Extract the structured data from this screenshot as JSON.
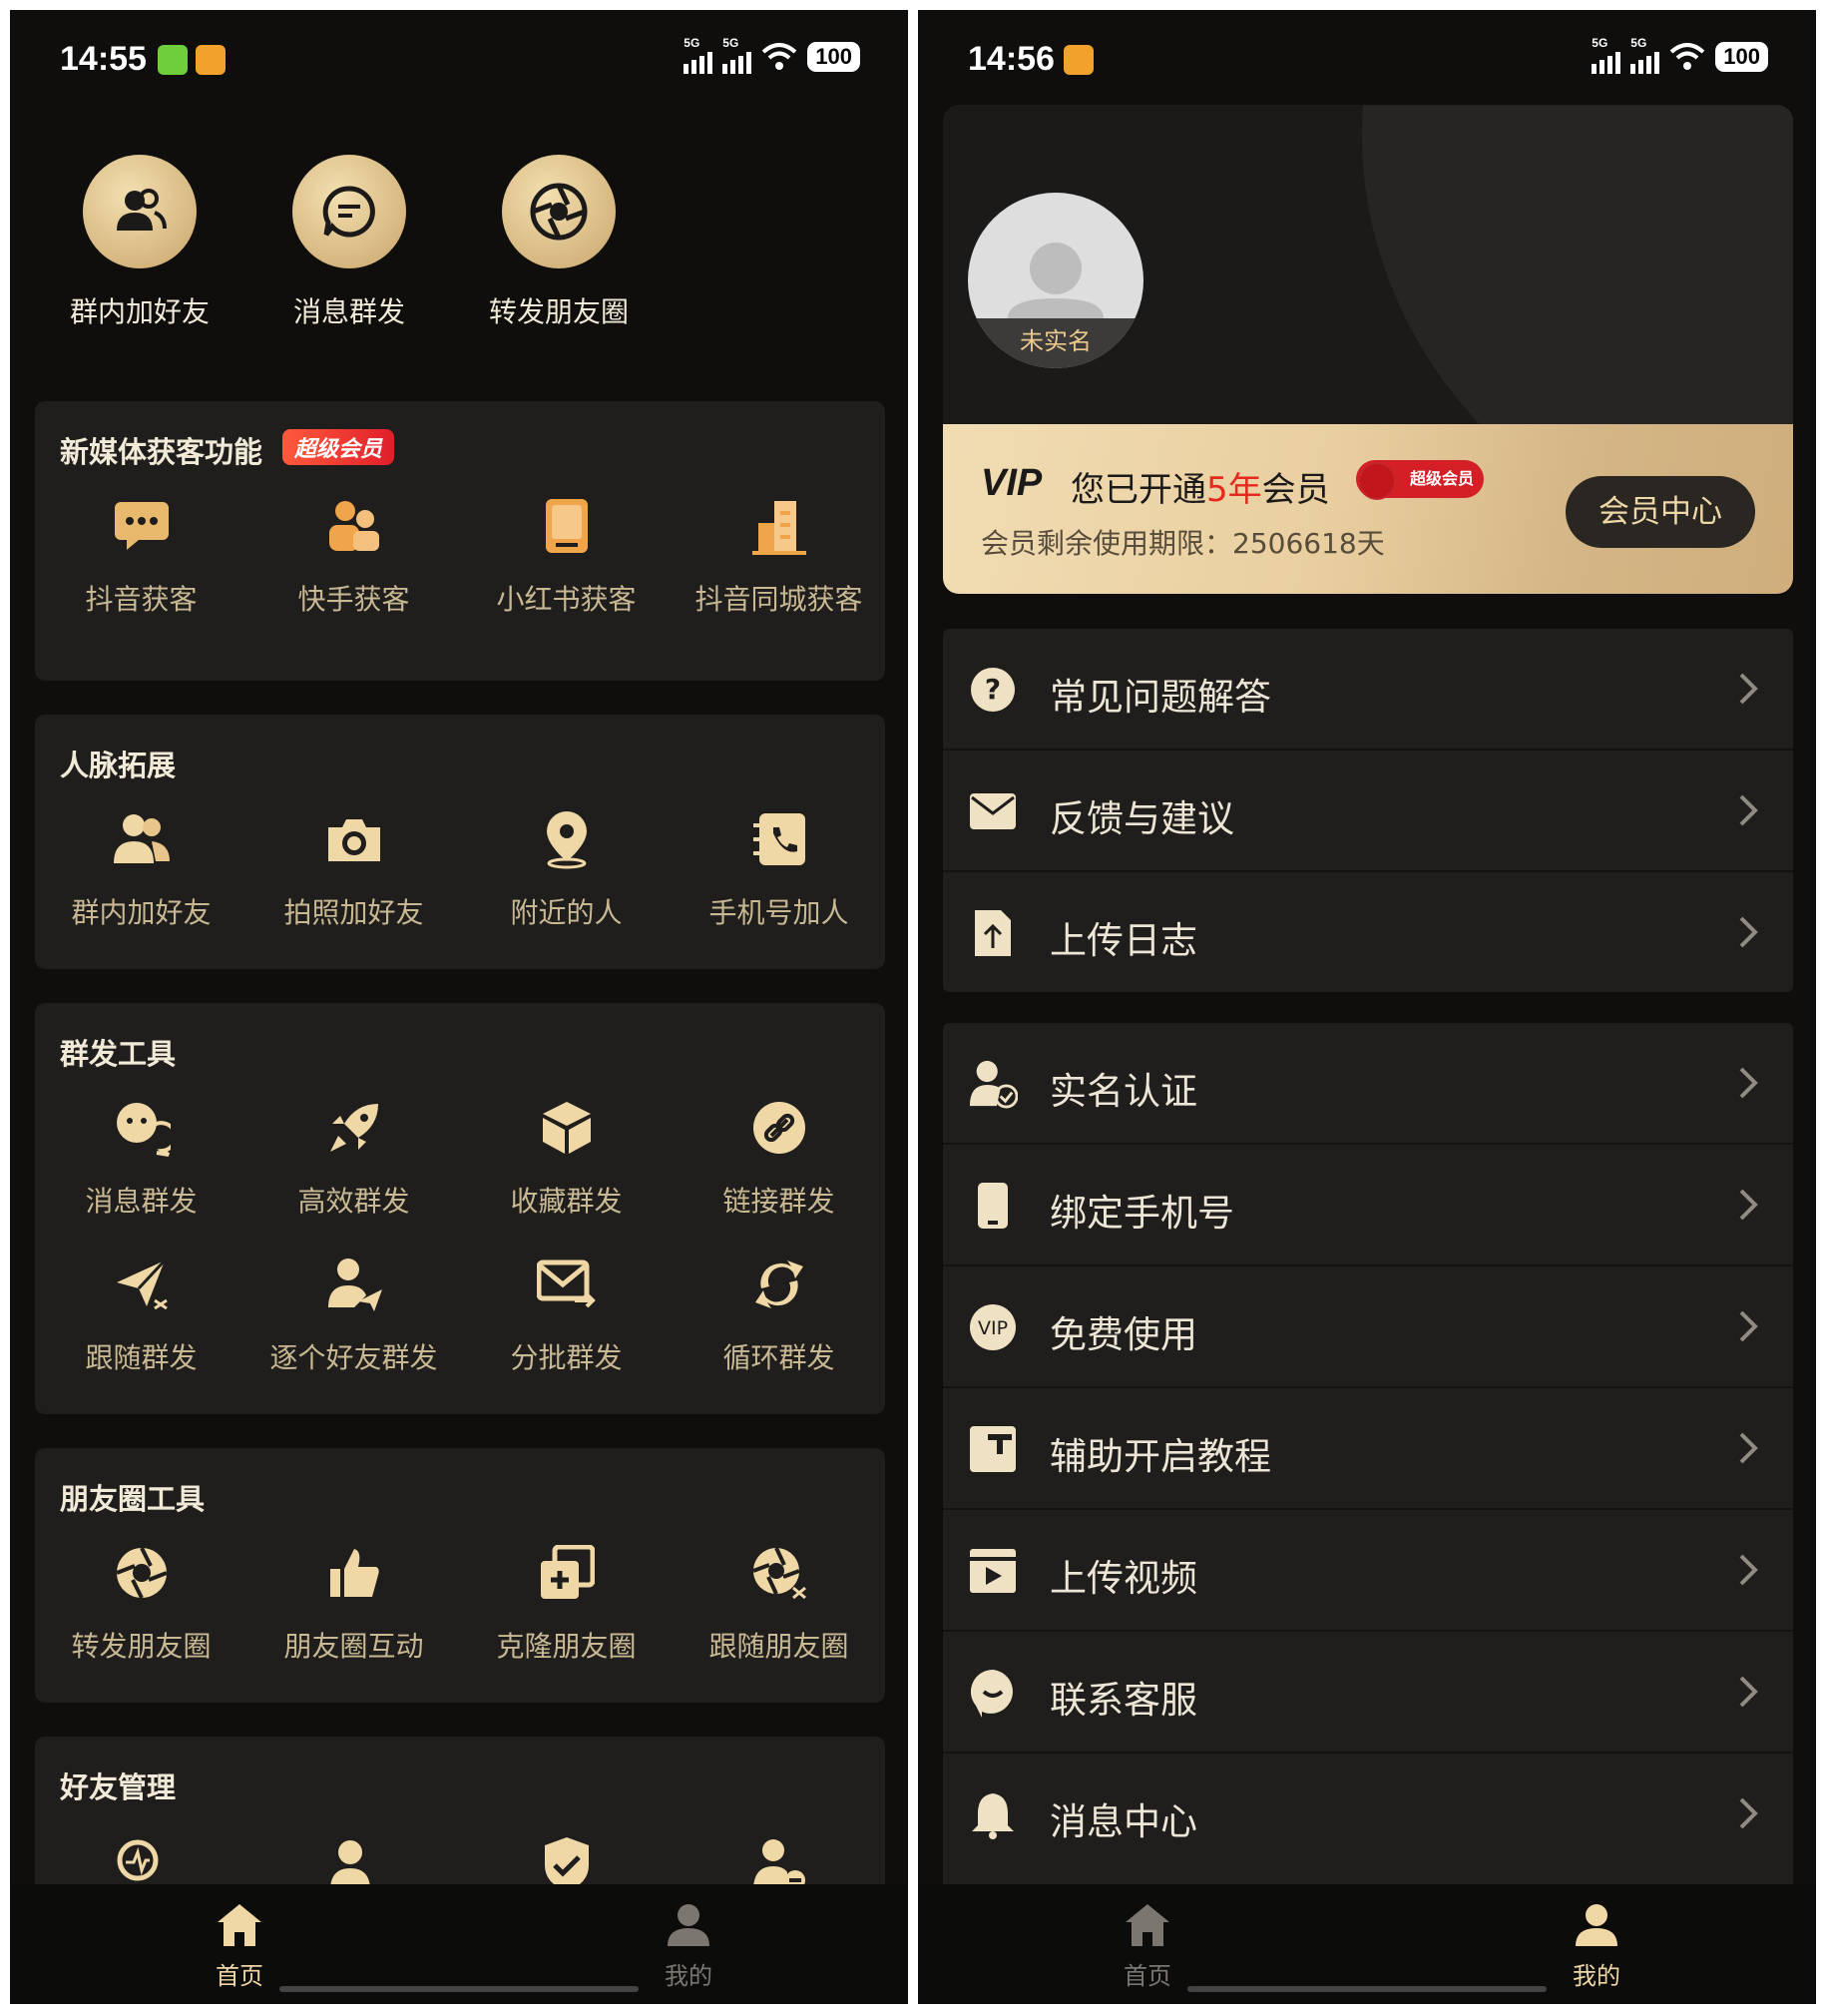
{
  "left": {
    "status_time": "14:55",
    "battery": "100",
    "signal_label": "5G",
    "shortcuts": [
      {
        "label": "群内加好友",
        "icon": "users-icon"
      },
      {
        "label": "消息群发",
        "icon": "chat-bubble-icon"
      },
      {
        "label": "转发朋友圈",
        "icon": "aperture-icon"
      }
    ],
    "sections": [
      {
        "title": "新媒体获客功能",
        "badge": "超级会员",
        "items": [
          {
            "label": "抖音获客",
            "icon": "message-icon"
          },
          {
            "label": "快手获客",
            "icon": "people-group-icon"
          },
          {
            "label": "小红书获客",
            "icon": "book-icon"
          },
          {
            "label": "抖音同城获客",
            "icon": "building-icon"
          }
        ]
      },
      {
        "title": "人脉拓展",
        "items": [
          {
            "label": "群内加好友",
            "icon": "users-icon"
          },
          {
            "label": "拍照加好友",
            "icon": "camera-icon"
          },
          {
            "label": "附近的人",
            "icon": "location-pin-icon"
          },
          {
            "label": "手机号加人",
            "icon": "phone-book-icon"
          }
        ]
      },
      {
        "title": "群发工具",
        "items": [
          {
            "label": "消息群发",
            "icon": "chat-bubbles-icon"
          },
          {
            "label": "高效群发",
            "icon": "rocket-icon"
          },
          {
            "label": "收藏群发",
            "icon": "box-icon"
          },
          {
            "label": "链接群发",
            "icon": "link-icon"
          },
          {
            "label": "跟随群发",
            "icon": "paper-plane-icon"
          },
          {
            "label": "逐个好友群发",
            "icon": "user-send-icon"
          },
          {
            "label": "分批群发",
            "icon": "mail-forward-icon"
          },
          {
            "label": "循环群发",
            "icon": "refresh-icon"
          }
        ]
      },
      {
        "title": "朋友圈工具",
        "items": [
          {
            "label": "转发朋友圈",
            "icon": "aperture-icon"
          },
          {
            "label": "朋友圈互动",
            "icon": "thumbs-up-icon"
          },
          {
            "label": "克隆朋友圈",
            "icon": "clone-icon"
          },
          {
            "label": "跟随朋友圈",
            "icon": "aperture-follow-icon"
          }
        ]
      },
      {
        "title": "好友管理",
        "items": [
          {
            "label": "",
            "icon": "search-pulse-icon"
          },
          {
            "label": "",
            "icon": "users-icon"
          },
          {
            "label": "",
            "icon": "shield-check-icon"
          },
          {
            "label": "",
            "icon": "user-remove-icon"
          }
        ]
      }
    ],
    "tabs": [
      {
        "label": "首页",
        "active": true
      },
      {
        "label": "我的",
        "active": false
      }
    ]
  },
  "right": {
    "status_time": "14:56",
    "battery": "100",
    "signal_label": "5G",
    "avatar_label": "未实名",
    "vip": {
      "logo": "VIP",
      "text_before": "您已开通",
      "text_highlight": "5年",
      "text_after": "会员",
      "mini_badge": "超级会员",
      "remaining": "会员剩余使用期限：2506618天",
      "button": "会员中心"
    },
    "menu_group1": [
      {
        "label": "常见问题解答",
        "icon": "question-icon"
      },
      {
        "label": "反馈与建议",
        "icon": "mail-icon"
      },
      {
        "label": "上传日志",
        "icon": "file-upload-icon"
      }
    ],
    "menu_group2": [
      {
        "label": "实名认证",
        "icon": "user-verified-icon"
      },
      {
        "label": "绑定手机号",
        "icon": "phone-icon"
      },
      {
        "label": "免费使用",
        "icon": "vip-icon"
      },
      {
        "label": "辅助开启教程",
        "icon": "tutorial-icon"
      },
      {
        "label": "上传视频",
        "icon": "video-icon"
      },
      {
        "label": "联系客服",
        "icon": "service-icon"
      },
      {
        "label": "消息中心",
        "icon": "bell-icon"
      }
    ],
    "tabs": [
      {
        "label": "首页",
        "active": false
      },
      {
        "label": "我的",
        "active": true
      }
    ]
  },
  "colors": {
    "gold": "#e9c98d",
    "bg": "#0f0e0d",
    "card": "#1f1e1c",
    "badge_red": "#e01e2a"
  }
}
